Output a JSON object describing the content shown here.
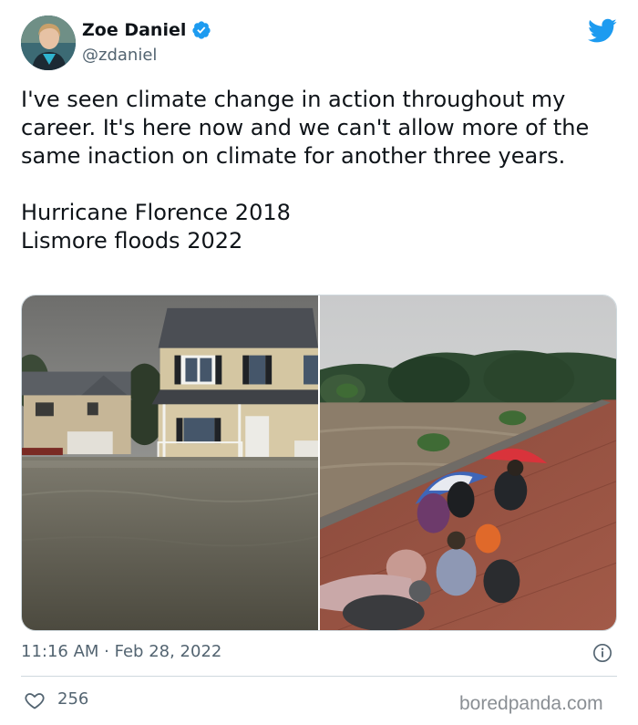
{
  "author": {
    "name": "Zoe Daniel",
    "handle": "@zdaniel",
    "verified": true
  },
  "tweet": {
    "text": "I've seen climate change in action throughout my career. It's here now and we can't allow more of the same inaction on climate for another three years.\n\nHurricane Florence 2018\nLismore floods 2022"
  },
  "media": [
    {
      "subject": "flooded-street-with-houses"
    },
    {
      "subject": "people-on-roof-above-floodwater"
    }
  ],
  "meta": {
    "timestamp": "11:16 AM · Feb 28, 2022"
  },
  "engagement": {
    "likes": "256"
  },
  "watermark": "boredpanda.com",
  "colors": {
    "brand_blue": "#1d9bf0",
    "secondary_text": "#536471",
    "border": "#cfd9de"
  }
}
